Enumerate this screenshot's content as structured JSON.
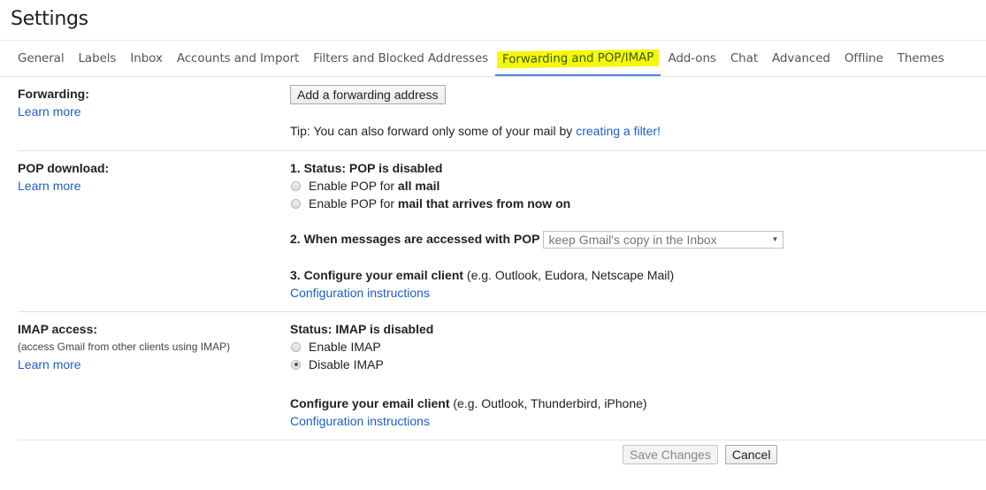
{
  "header": {
    "title": "Settings"
  },
  "tabs": [
    {
      "label": "General",
      "active": false
    },
    {
      "label": "Labels",
      "active": false
    },
    {
      "label": "Inbox",
      "active": false
    },
    {
      "label": "Accounts and Import",
      "active": false
    },
    {
      "label": "Filters and Blocked Addresses",
      "active": false
    },
    {
      "label": "Forwarding and POP/IMAP",
      "active": true,
      "highlight_color": "#f6f80a"
    },
    {
      "label": "Add-ons",
      "active": false
    },
    {
      "label": "Chat",
      "active": false
    },
    {
      "label": "Advanced",
      "active": false
    },
    {
      "label": "Offline",
      "active": false
    },
    {
      "label": "Themes",
      "active": false
    }
  ],
  "forwarding": {
    "label": "Forwarding:",
    "learn_more": "Learn more",
    "add_button": "Add a forwarding address",
    "tip_prefix": "Tip: You can also forward only some of your mail by ",
    "tip_link": "creating a filter!"
  },
  "pop": {
    "label": "POP download:",
    "learn_more": "Learn more",
    "status": "1. Status: POP is disabled",
    "options": [
      {
        "prefix": "Enable POP for ",
        "bold": "all mail",
        "checked": false
      },
      {
        "prefix": "Enable POP for ",
        "bold": "mail that arrives from now on",
        "checked": false
      }
    ],
    "when_accessed_label": "2. When messages are accessed with POP",
    "when_accessed_value": "keep Gmail's copy in the Inbox",
    "configure_bold": "3. Configure your email client",
    "configure_rest": " (e.g. Outlook, Eudora, Netscape Mail)",
    "config_link": "Configuration instructions"
  },
  "imap": {
    "label": "IMAP access:",
    "sublabel": "(access Gmail from other clients using IMAP)",
    "learn_more": "Learn more",
    "status": "Status: IMAP is disabled",
    "options": [
      {
        "label": "Enable IMAP",
        "checked": false
      },
      {
        "label": "Disable IMAP",
        "checked": true
      }
    ],
    "configure_bold": "Configure your email client",
    "configure_rest": " (e.g. Outlook, Thunderbird, iPhone)",
    "config_link": "Configuration instructions"
  },
  "footer": {
    "save_label": "Save Changes",
    "cancel_label": "Cancel"
  }
}
